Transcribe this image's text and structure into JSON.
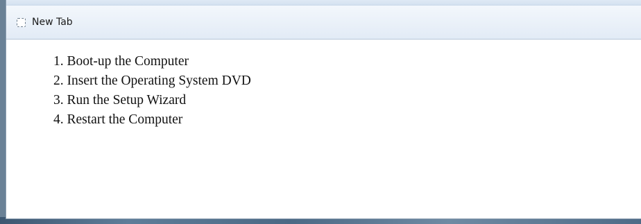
{
  "tab": {
    "label": "New Tab",
    "icon": "blank-page-icon"
  },
  "steps": [
    {
      "number": "1",
      "text": "Boot-up the Computer"
    },
    {
      "number": "2",
      "text": "Insert the Operating System DVD"
    },
    {
      "number": "3",
      "text": "Run the Setup Wizard"
    },
    {
      "number": "4",
      "text": "Restart the Computer"
    }
  ]
}
